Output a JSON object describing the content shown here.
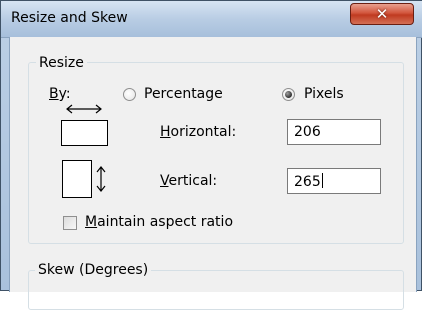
{
  "window": {
    "title": "Resize and Skew"
  },
  "resize": {
    "group_label": "Resize",
    "by_label": "By:",
    "percentage_label": "Percentage",
    "pixels_label": "Pixels",
    "selected": "Pixels",
    "horizontal_label": "Horizontal:",
    "horizontal_value": "206",
    "vertical_label": "Vertical:",
    "vertical_value": "265",
    "maintain_aspect_label": "Maintain aspect ratio",
    "maintain_aspect_checked": false
  },
  "skew": {
    "group_label": "Skew (Degrees)"
  },
  "icons": {
    "close": "close-icon",
    "horizontal_arrow": "horizontal-resize-arrow-icon",
    "vertical_arrow": "vertical-resize-arrow-icon"
  }
}
